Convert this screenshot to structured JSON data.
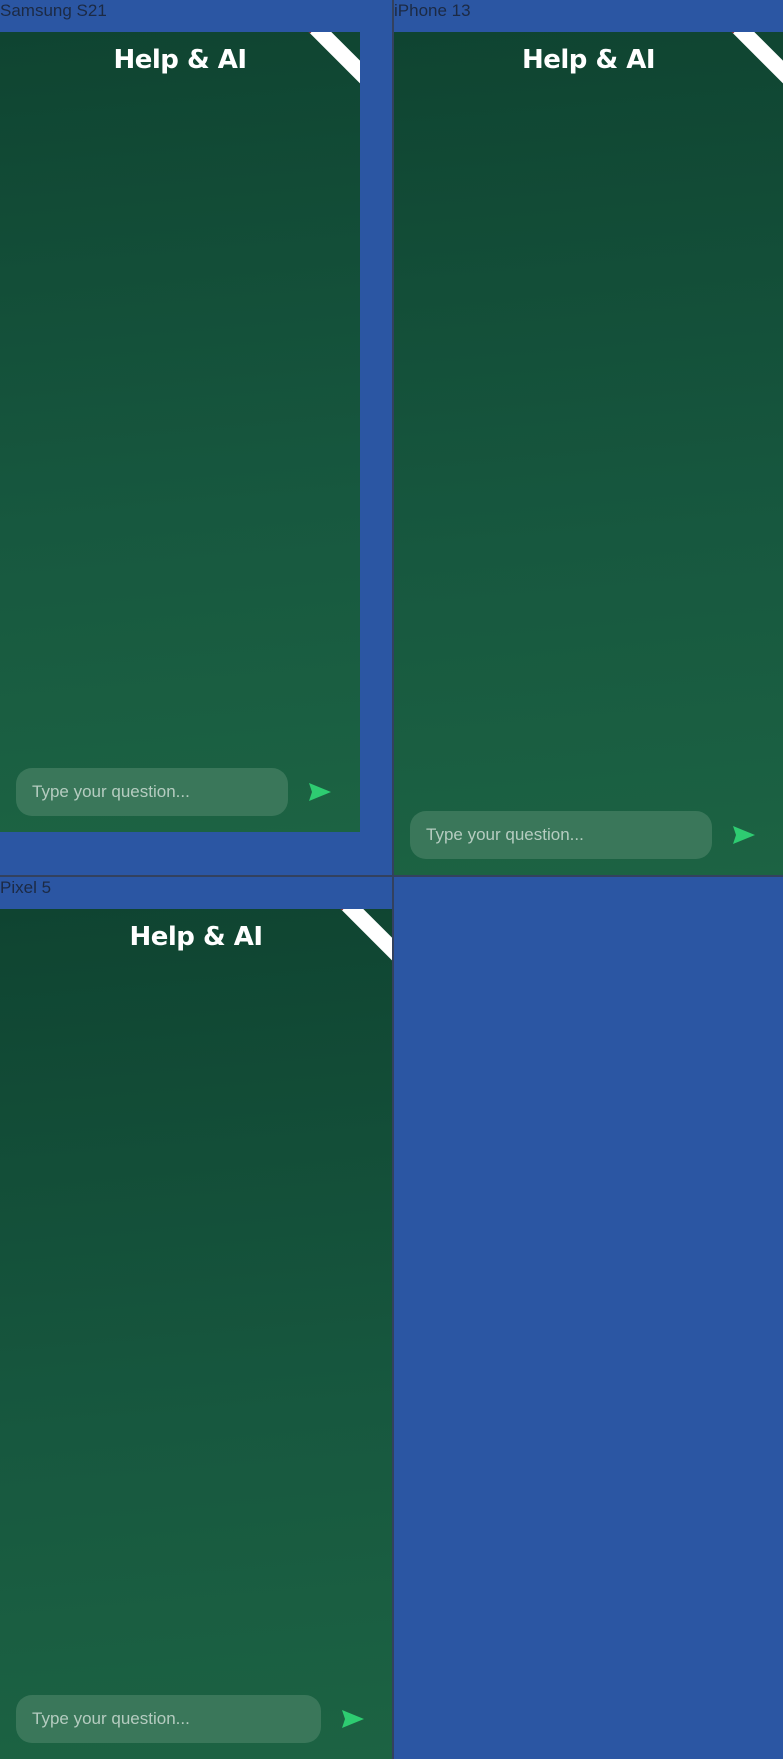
{
  "devices": [
    {
      "label": "Samsung S21",
      "title": "Help & AI",
      "input_placeholder": "Type your question..."
    },
    {
      "label": "iPhone 13",
      "title": "Help & AI",
      "input_placeholder": "Type your question..."
    },
    {
      "label": "Pixel 5",
      "title": "Help & AI",
      "input_placeholder": "Type your question..."
    }
  ],
  "colors": {
    "canvas_background": "#2b56a3",
    "screen_gradient_top": "#0f4431",
    "screen_gradient_bottom": "#1c6343",
    "send_icon": "#2ecc71",
    "debug_banner_edge": "#7f1d2a"
  },
  "icons": {
    "send": "send-icon",
    "banner": "debug-banner"
  }
}
